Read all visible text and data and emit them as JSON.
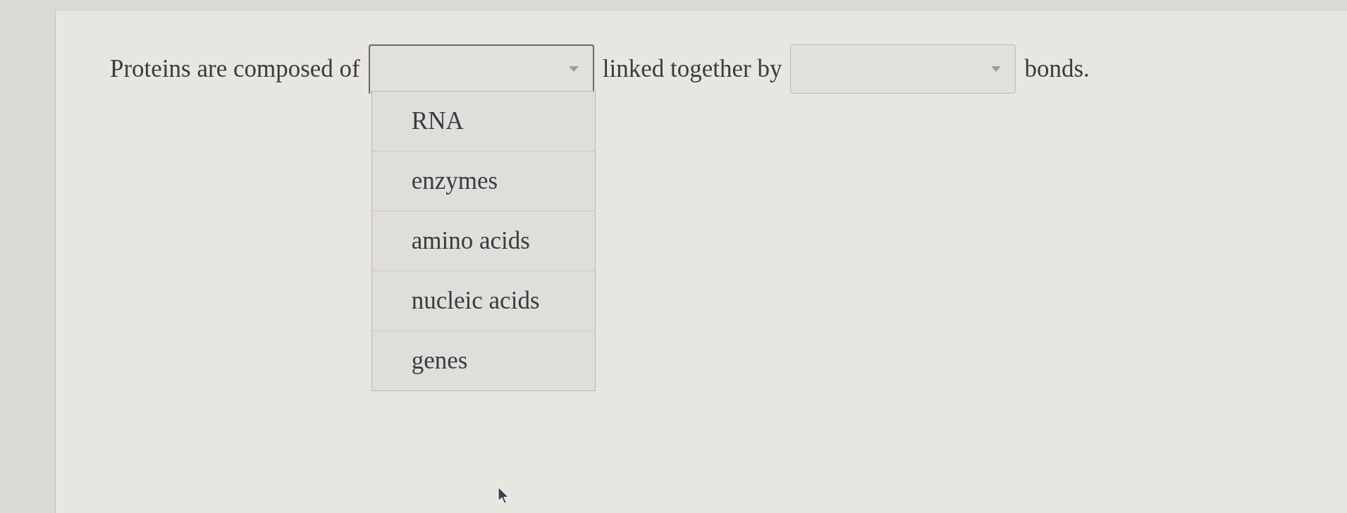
{
  "question": {
    "segments": [
      {
        "kind": "text",
        "text": "Proteins are composed of"
      },
      {
        "kind": "dropdown",
        "expanded": true,
        "options": [
          {
            "label": "RNA",
            "selected": false
          },
          {
            "label": "enzymes",
            "selected": false
          },
          {
            "label": "amino acids",
            "selected": false
          },
          {
            "label": "nucleic acids",
            "selected": false
          },
          {
            "label": "genes",
            "selected": false
          }
        ]
      },
      {
        "kind": "text",
        "text": "linked together by"
      },
      {
        "kind": "dropdown",
        "expanded": false
      },
      {
        "kind": "text",
        "text": "bonds."
      }
    ]
  }
}
